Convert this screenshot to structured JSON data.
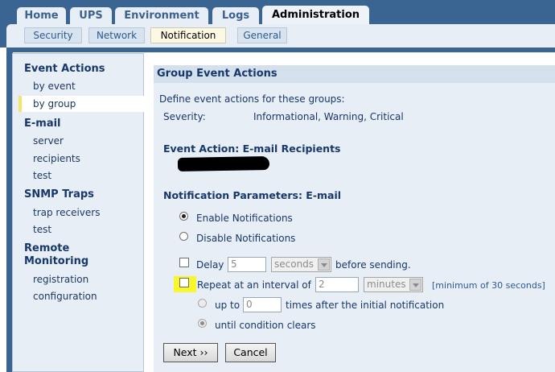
{
  "top_tabs": [
    {
      "label": "Home",
      "active": false
    },
    {
      "label": "UPS",
      "active": false
    },
    {
      "label": "Environment",
      "active": false
    },
    {
      "label": "Logs",
      "active": false
    },
    {
      "label": "Administration",
      "active": true
    }
  ],
  "sub_tabs": [
    {
      "label": "Security",
      "active": false
    },
    {
      "label": "Network",
      "active": false
    },
    {
      "label": "Notification",
      "active": true
    },
    {
      "label": "General",
      "active": false
    }
  ],
  "sidebar": {
    "event_actions": {
      "heading": "Event Actions",
      "items": [
        "by event",
        "by group"
      ],
      "selected": "by group"
    },
    "email": {
      "heading": "E-mail",
      "items": [
        "server",
        "recipients",
        "test"
      ]
    },
    "snmp": {
      "heading": "SNMP Traps",
      "items": [
        "trap receivers",
        "test"
      ]
    },
    "remote": {
      "heading_line1": "Remote",
      "heading_line2": "Monitoring",
      "items": [
        "registration",
        "configuration"
      ]
    }
  },
  "content": {
    "title": "Group Event Actions",
    "intro": "Define event actions for these groups:",
    "severity_label": "Severity:",
    "severity_value": "Informational, Warning, Critical",
    "event_action_heading": "Event Action: E-mail Recipients",
    "params_heading": "Notification Parameters: E-mail",
    "enable_label": "Enable Notifications",
    "disable_label": "Disable Notifications",
    "notifications_enabled": true,
    "delay": {
      "label": "Delay",
      "value": "5",
      "unit": "seconds",
      "suffix": "before sending.",
      "checked": false
    },
    "repeat": {
      "label": "Repeat at an interval of",
      "value": "2",
      "unit": "minutes",
      "note": "[minimum of 30 seconds]",
      "checked": false
    },
    "up_to": {
      "label": "up to",
      "value": "0",
      "suffix": "times after the initial notification",
      "selected": false
    },
    "until_label": "until condition clears",
    "until_selected": true,
    "next_label": "Next ››",
    "cancel_label": "Cancel"
  },
  "colors": {
    "header_blue": "#3a6592",
    "panel": "#e8eef6",
    "text_blue": "#17386a",
    "highlight": "#f7f72a"
  }
}
